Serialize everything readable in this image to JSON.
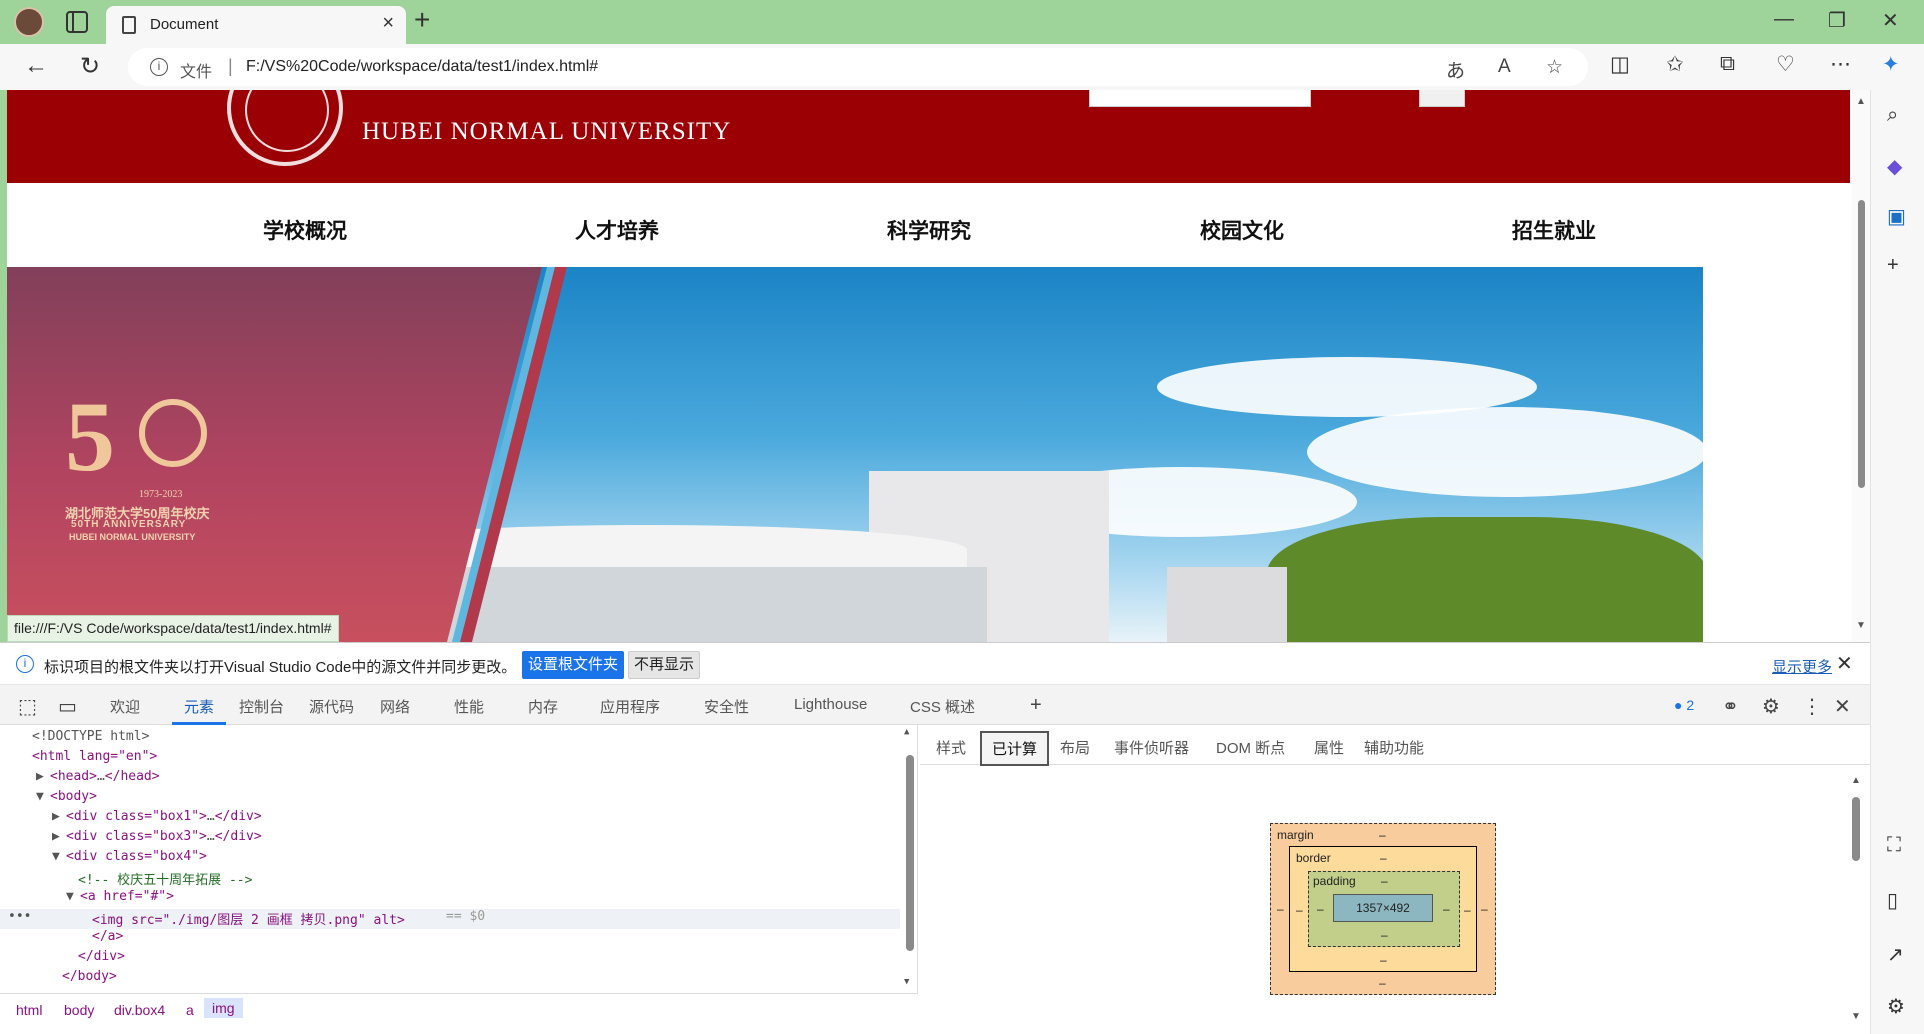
{
  "browser": {
    "tab_title": "Document",
    "url_scheme": "文件",
    "url": "F:/VS%20Code/workspace/data/test1/index.html#",
    "icons": [
      "profile-avatar",
      "tab-actions-icon",
      "document-icon",
      "close-icon",
      "plus-icon",
      "minimize-icon",
      "restore-icon",
      "back-icon",
      "refresh-icon",
      "info-icon",
      "translate-icon",
      "read-aloud-icon",
      "favorite-star-icon",
      "split-screen-icon",
      "favorites-icon",
      "collections-icon",
      "performance-icon",
      "more-icon",
      "copilot-icon"
    ]
  },
  "sidebar": {
    "items": [
      "search-icon",
      "copilot-icon",
      "outlook-icon",
      "add-icon",
      "screenshot-icon",
      "sidepane-icon",
      "external-link-icon",
      "settings-icon"
    ]
  },
  "page": {
    "university_en": "HUBEI NORMAL UNIVERSITY",
    "nav": [
      "学校概况",
      "人才培养",
      "科学研究",
      "校园文化",
      "招生就业"
    ],
    "anniversary": {
      "years": "1973-2023",
      "title_cn": "湖北师范大学50周年校庆",
      "title_en": "50TH ANNIVERSARY",
      "subtitle_en": "HUBEI NORMAL UNIVERSITY"
    },
    "status_link": "file:///F:/VS Code/workspace/data/test1/index.html#"
  },
  "devtools": {
    "infobar": {
      "message": "标识项目的根文件夹以打开Visual Studio Code中的源文件并同步更改。",
      "primary_button": "设置根文件夹",
      "secondary_button": "不再显示",
      "more_link": "显示更多"
    },
    "tabs": [
      "欢迎",
      "元素",
      "控制台",
      "源代码",
      "网络",
      "性能",
      "内存",
      "应用程序",
      "安全性",
      "Lighthouse",
      "CSS 概述"
    ],
    "active_tab": "元素",
    "issues_count": "2",
    "dom": {
      "doctype": "<!DOCTYPE html>",
      "html_open": "<html lang=\"en\">",
      "head_open": "<head>",
      "head_close": "</head>",
      "body_open": "<body>",
      "box1_open": "<div class=\"box1\">",
      "box3_open": "<div class=\"box3\">",
      "div_close": "</div>",
      "box4_open": "<div class=\"box4\">",
      "comment": "<!-- 校庆五十周年拓展 -->",
      "a_open": "<a href=\"#\">",
      "img_tag": "<img src=\"./img/图层 2 画框 拷贝.png\" alt>",
      "selected_marker": "== $0",
      "a_close": "</a>",
      "box4_close": "</div>",
      "body_close": "</body>",
      "ellipsis": "…"
    },
    "breadcrumbs": [
      "html",
      "body",
      "div.box4",
      "a",
      "img"
    ],
    "side_tabs": [
      "样式",
      "已计算",
      "布局",
      "事件侦听器",
      "DOM 断点",
      "属性",
      "辅助功能"
    ],
    "active_side_tab": "已计算",
    "box_model": {
      "margin_label": "margin",
      "border_label": "border",
      "padding_label": "padding",
      "content_size": "1357×492",
      "dash": "–"
    }
  }
}
